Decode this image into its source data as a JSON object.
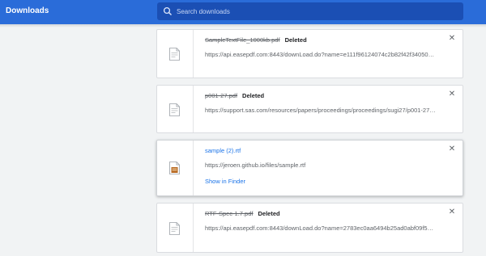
{
  "header": {
    "title": "Downloads",
    "search_placeholder": "Search downloads"
  },
  "downloads": [
    {
      "file_name": "SampleTextFile_1000kb.pdf",
      "status": "Deleted",
      "url": "https://api.easepdf.com:8443/downLoad.do?name=e111f96124074c2b82f42f340501a…",
      "icon": "pdf-file-icon"
    },
    {
      "file_name": "p001-27.pdf",
      "status": "Deleted",
      "url": "https://support.sas.com/resources/papers/proceedings/proceedings/sugi27/p001-27.p…",
      "icon": "pdf-file-icon"
    },
    {
      "file_name": "sample (2).rtf",
      "status": "",
      "url": "https://jeroen.github.io/files/sample.rtf",
      "action": "Show in Finder",
      "icon": "rtf-file-icon"
    },
    {
      "file_name": "RTF-Spec-1.7.pdf",
      "status": "Deleted",
      "url": "https://api.easepdf.com:8443/downLoad.do?name=2783ec0aa6494b25ad0abf09f59ffa…",
      "icon": "pdf-file-icon"
    }
  ],
  "colors": {
    "header_bg": "#2a6cd9",
    "search_bg": "#1b4fb4",
    "link": "#1a73e8",
    "page_bg": "#f1f3f4"
  }
}
